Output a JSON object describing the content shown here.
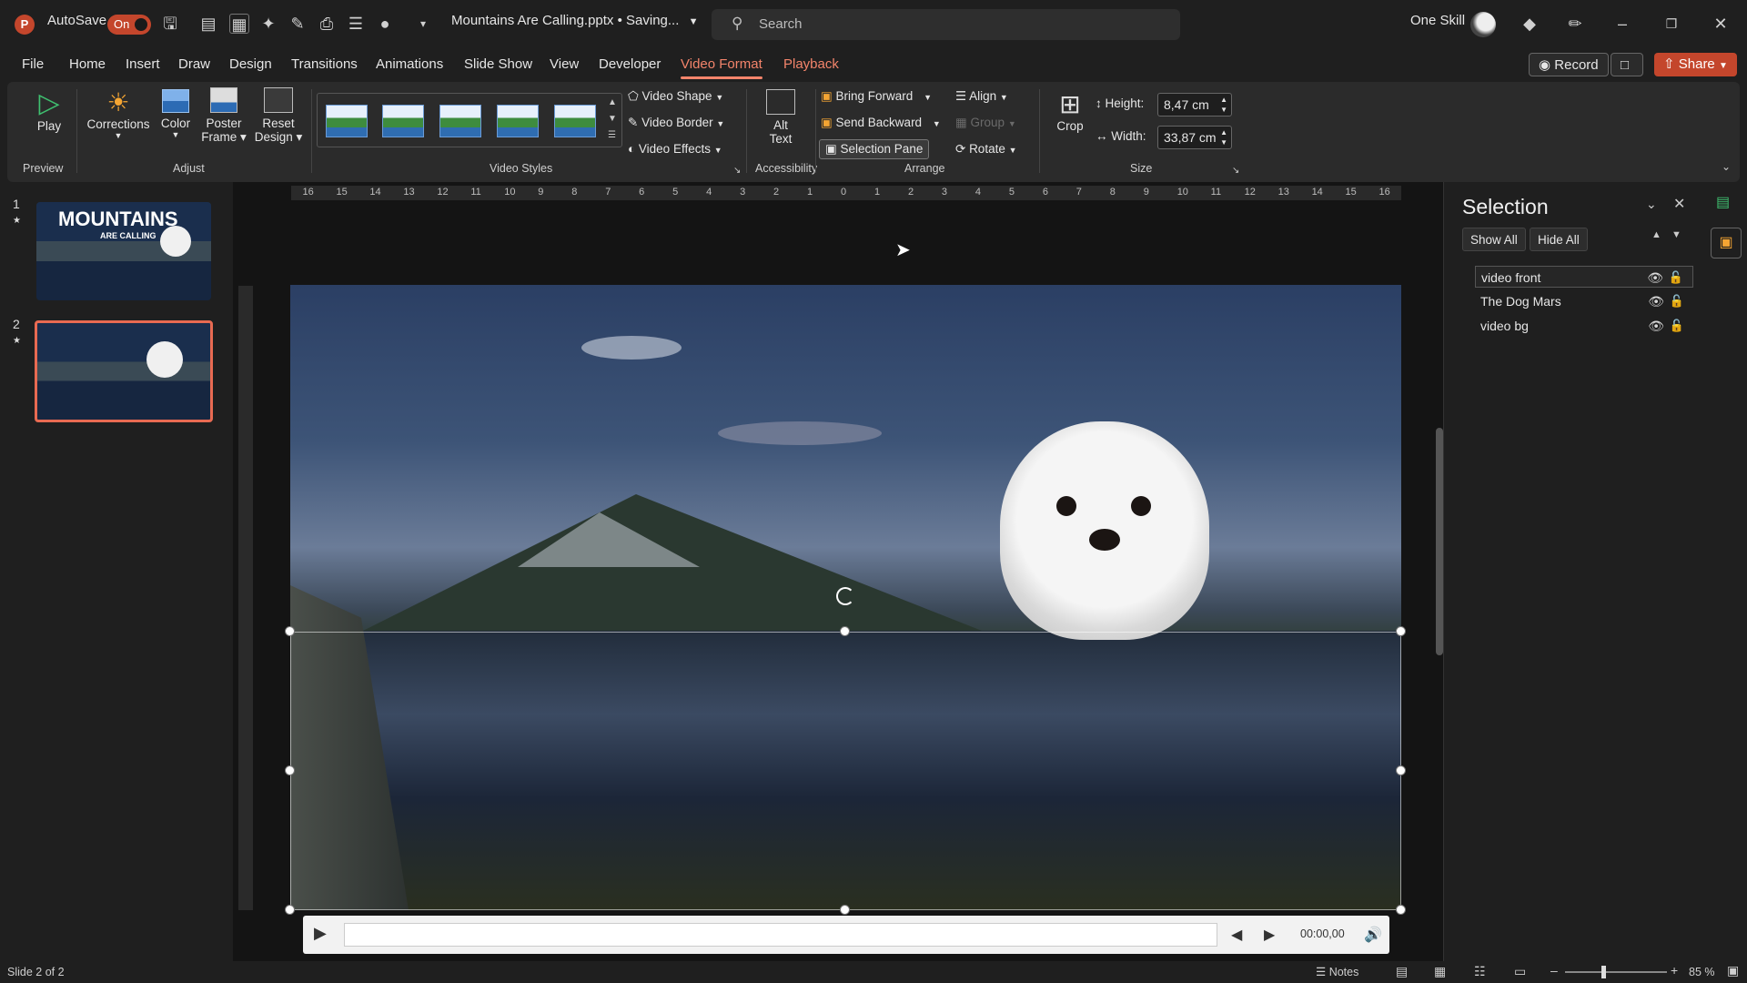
{
  "titlebar": {
    "autosave_label": "AutoSave",
    "autosave_state": "On",
    "document_title": "Mountains Are Calling.pptx • Saving...",
    "search_placeholder": "Search",
    "user_name": "One Skill"
  },
  "tabs": {
    "file": "File",
    "home": "Home",
    "insert": "Insert",
    "draw": "Draw",
    "design": "Design",
    "transitions": "Transitions",
    "animations": "Animations",
    "slide_show": "Slide Show",
    "view": "View",
    "developer": "Developer",
    "video_format": "Video Format",
    "playback": "Playback",
    "record": "Record",
    "share": "Share"
  },
  "ribbon": {
    "play": "Play",
    "corrections": "Corrections",
    "color": "Color",
    "poster_frame_1": "Poster",
    "poster_frame_2": "Frame",
    "reset_design_1": "Reset",
    "reset_design_2": "Design",
    "video_shape": "Video Shape",
    "video_border": "Video Border",
    "video_effects": "Video Effects",
    "alt_text_1": "Alt",
    "alt_text_2": "Text",
    "bring_forward": "Bring Forward",
    "send_backward": "Send Backward",
    "selection_pane": "Selection Pane",
    "align": "Align",
    "group": "Group",
    "rotate": "Rotate",
    "crop": "Crop",
    "height_label": "Height:",
    "height_value": "8,47 cm",
    "width_label": "Width:",
    "width_value": "33,87 cm",
    "groups": {
      "preview": "Preview",
      "adjust": "Adjust",
      "video_styles": "Video Styles",
      "accessibility": "Accessibility",
      "arrange": "Arrange",
      "size": "Size"
    }
  },
  "thumbnails": [
    {
      "number": "1",
      "title_line1": "MOUNTAINS",
      "title_line2": "ARE CALLING"
    },
    {
      "number": "2"
    }
  ],
  "ruler": {
    "horizontal": [
      "16",
      "15",
      "14",
      "13",
      "12",
      "11",
      "10",
      "9",
      "8",
      "7",
      "6",
      "5",
      "4",
      "3",
      "2",
      "1",
      "0",
      "1",
      "2",
      "3",
      "4",
      "5",
      "6",
      "7",
      "8",
      "9",
      "10",
      "11",
      "12",
      "13",
      "14",
      "15",
      "16"
    ]
  },
  "player": {
    "time": "00:00,00"
  },
  "selection_pane": {
    "title": "Selection",
    "show_all": "Show All",
    "hide_all": "Hide All",
    "items": [
      {
        "name": "video front"
      },
      {
        "name": "The Dog Mars"
      },
      {
        "name": "video bg"
      }
    ]
  },
  "status": {
    "slide_info": "Slide 2 of 2",
    "notes": "Notes",
    "zoom": "85 %"
  },
  "colors": {
    "accent": "#f3846b",
    "share_bg": "#c4462c",
    "selected_thumb_border": "#e86a52"
  }
}
